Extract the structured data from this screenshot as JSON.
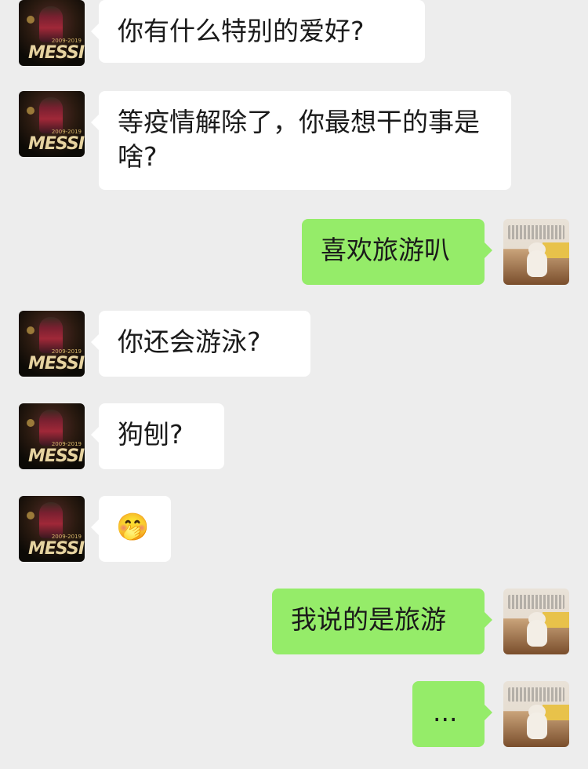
{
  "messages": [
    {
      "side": "left",
      "text": "你有什么特别的爱好?"
    },
    {
      "side": "left",
      "text": "等疫情解除了，你最想干的事是啥?"
    },
    {
      "side": "right",
      "text": "喜欢旅游叭"
    },
    {
      "side": "left",
      "text": "你还会游泳?"
    },
    {
      "side": "left",
      "text": "狗刨?"
    },
    {
      "side": "left",
      "text": "🤭"
    },
    {
      "side": "right",
      "text": "我说的是旅游"
    },
    {
      "side": "right",
      "text": "..."
    }
  ],
  "avatars": {
    "left_label": "MESSI",
    "left_years": "2009-2019",
    "right_icon": "cat-meme-avatar"
  },
  "colors": {
    "background": "#ededed",
    "incoming_bubble": "#ffffff",
    "outgoing_bubble": "#95ec69"
  }
}
